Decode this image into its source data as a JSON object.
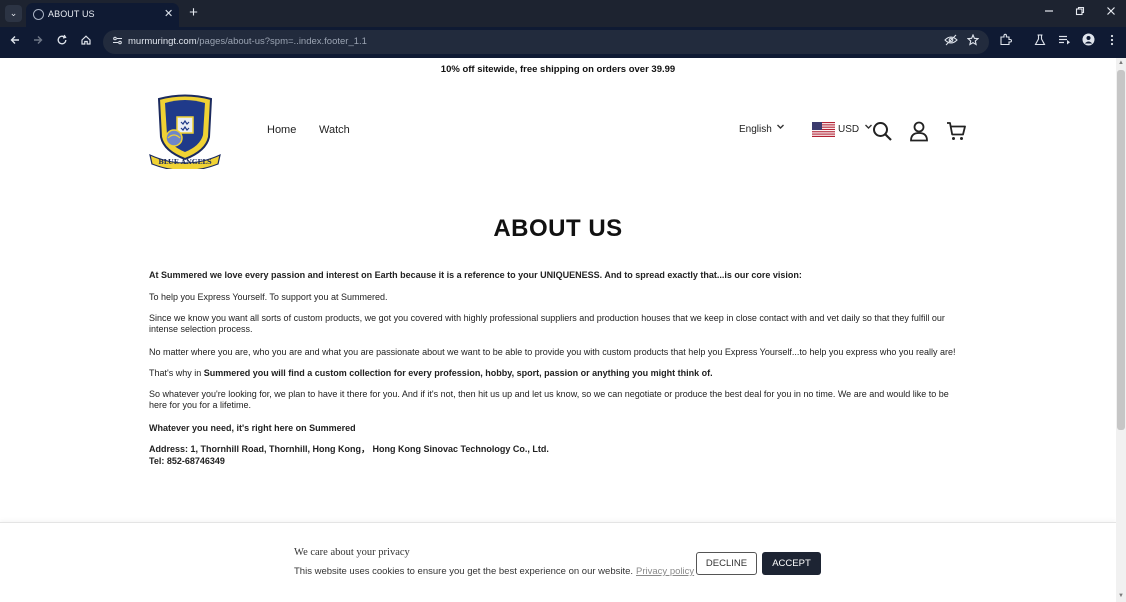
{
  "browser": {
    "tab_title": "ABOUT US",
    "tab_close": "✕",
    "new_tab": "+",
    "url_host": "murmuringt.com",
    "url_path": "/pages/about-us?spm=..index.footer_1.1"
  },
  "page": {
    "announcement": "10% off sitewide, free shipping on orders over 39.99",
    "nav": [
      "Home",
      "Watch"
    ],
    "language": "English",
    "currency": "USD",
    "logo_text": "BLUE ANGELS",
    "title": "ABOUT US",
    "content": {
      "vision": "At Summered we love every passion and interest on Earth because it is a reference to your UNIQUENESS. And to spread exactly that...is our core vision:",
      "help": "To help you Express Yourself. To support you at Summered.",
      "since": "Since we know you want all sorts of custom products, we got you covered with highly professional suppliers and production houses that we keep in close contact with and vet daily so that they fulfill our intense selection process.",
      "no_matter": "No matter where you are, who you are and what you are passionate about we want to be able to provide you with custom products that help you Express Yourself...to help you express who you really are!",
      "thats_why_prefix": "That's why in ",
      "thats_why_bold": "Summered you will find a custom collection for every profession, hobby, sport, passion or anything you might think of.",
      "so_whatever": "So whatever you're looking for, we plan to have it there for you. And if it's not, then hit us up and let us know, so we can negotiate or produce the best deal for you in no time. We are and would like to be here for you for a lifetime.",
      "whatever_need": "Whatever you need, it's right here on Summered",
      "address": "Address: 1, Thornhill Road, Thornhill, Hong Kong，  Hong Kong Sinovac Technology Co., Ltd.",
      "tel": "Tel: 852-68746349"
    }
  },
  "cookie": {
    "title": "We care about your privacy",
    "text": "This website uses cookies to ensure you get the best experience on our website.",
    "link": "Privacy policy",
    "decline": "DECLINE",
    "accept": "ACCEPT"
  },
  "icons": [
    "tab-list-icon",
    "favicon-icon",
    "close-icon",
    "plus-icon",
    "minimize-icon",
    "restore-icon",
    "window-close-icon",
    "back-icon",
    "forward-icon",
    "reload-icon",
    "home-icon",
    "site-info-icon",
    "eye-off-icon",
    "star-icon",
    "extensions-icon",
    "labs-icon",
    "media-icon",
    "profile-icon",
    "menu-icon",
    "search-icon",
    "account-icon",
    "cart-icon",
    "chevron-down-icon",
    "us-flag-icon"
  ]
}
